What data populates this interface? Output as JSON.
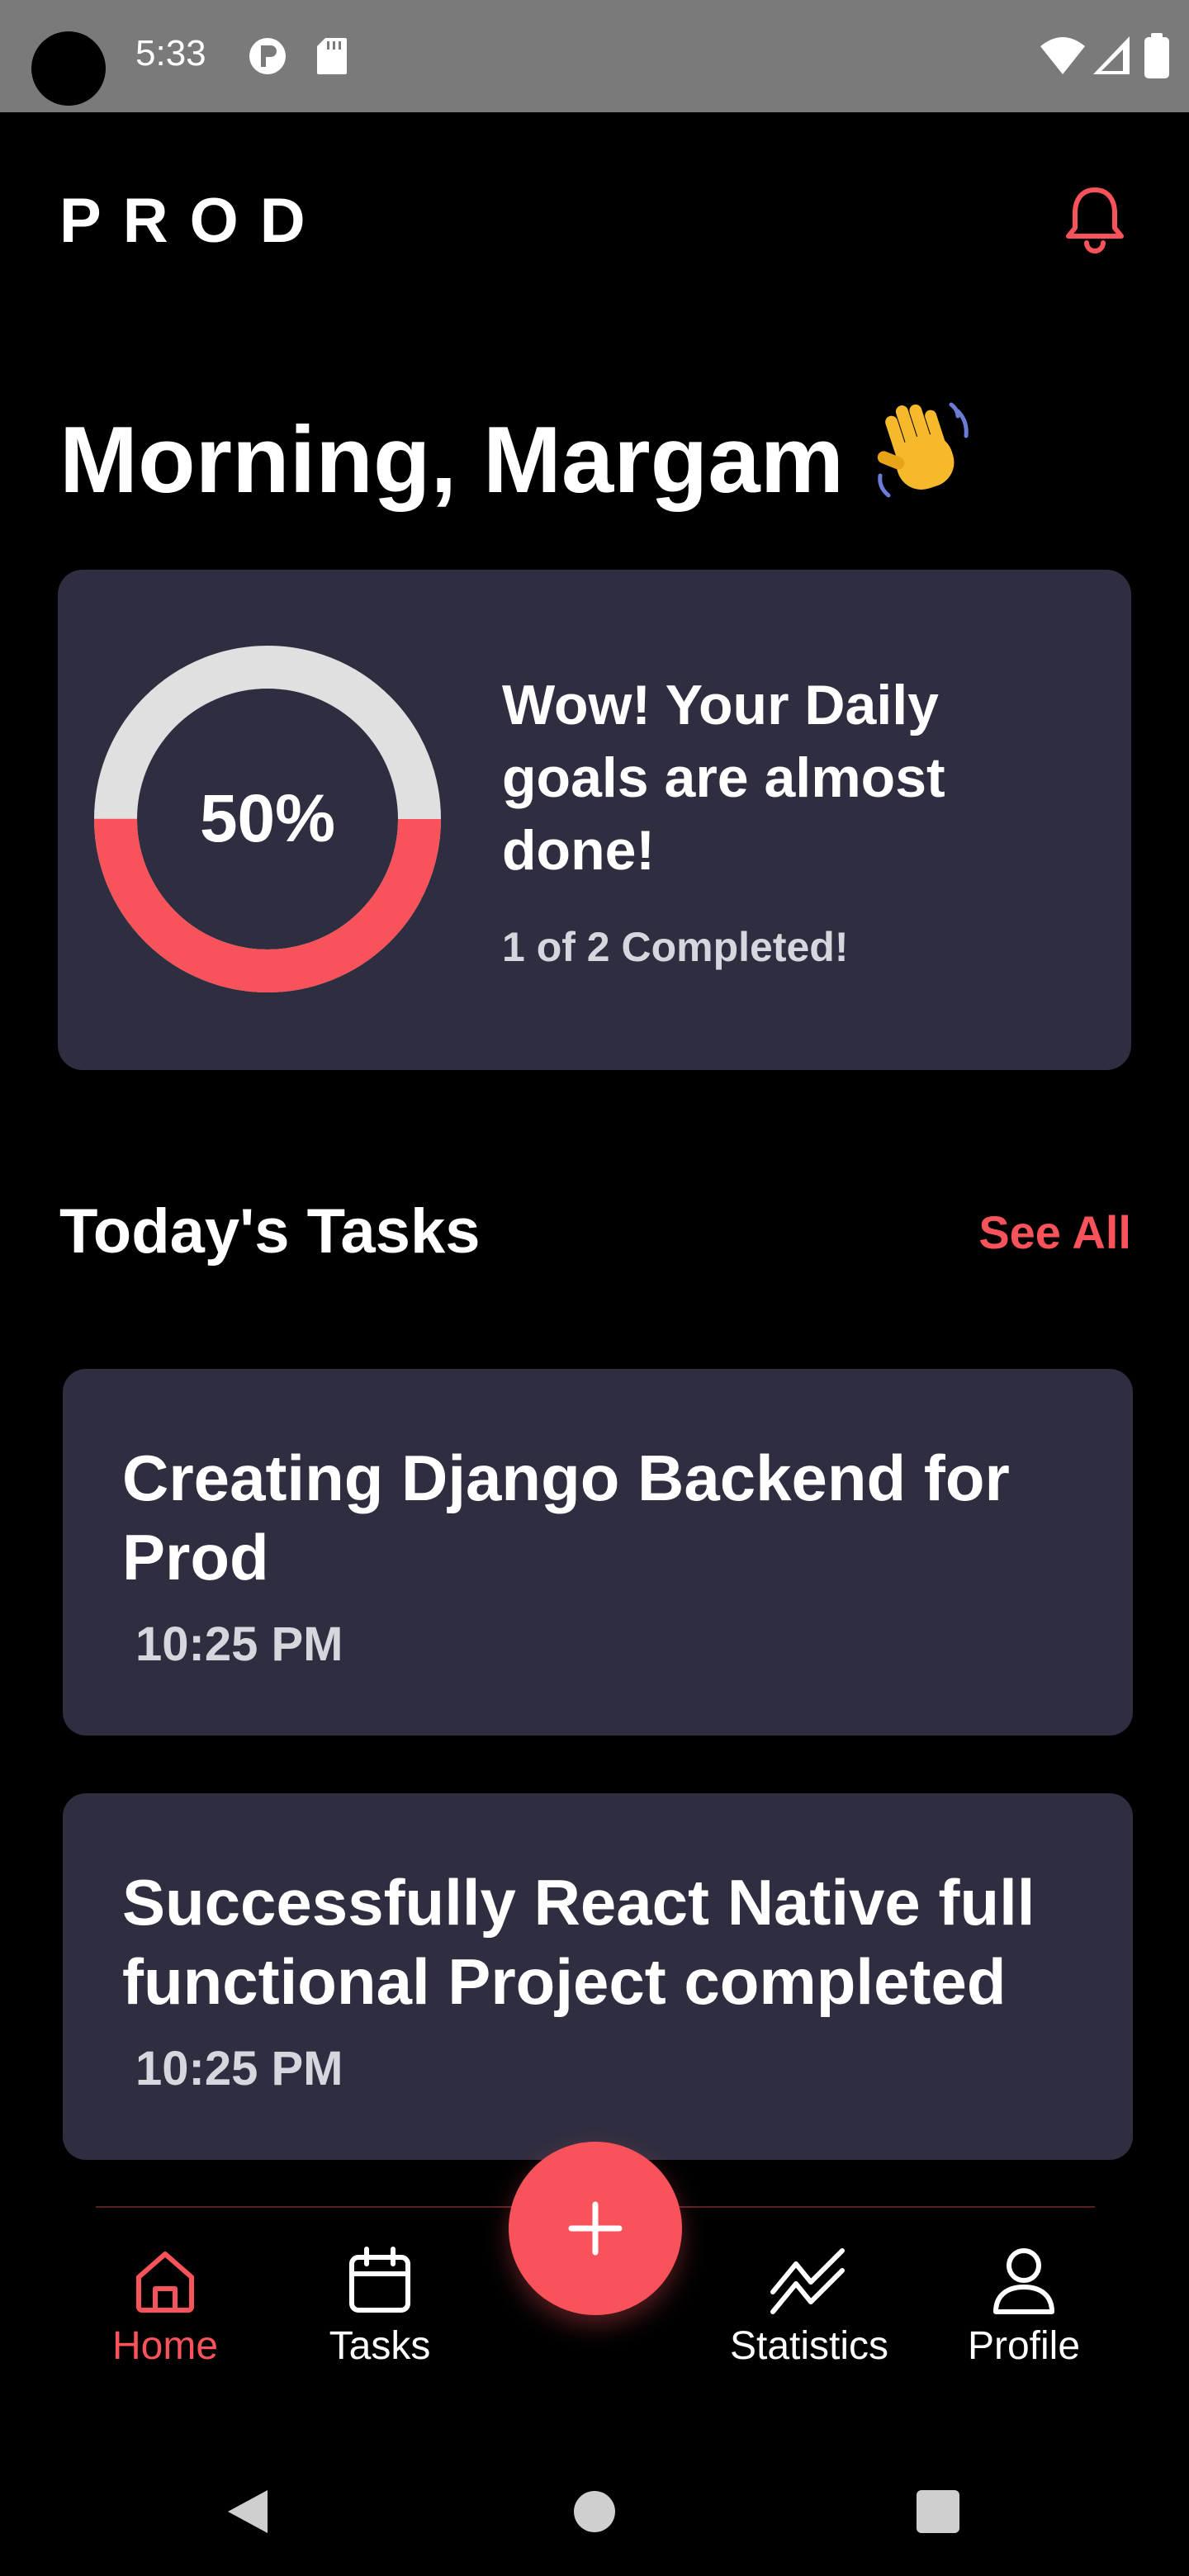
{
  "status_bar": {
    "time": "5:33",
    "icons": [
      "camera-cutout",
      "notification-p-icon",
      "sd-card-icon",
      "wifi-icon",
      "signal-icon",
      "battery-icon"
    ]
  },
  "header": {
    "logo": "PROD",
    "notification_icon": "bell-icon"
  },
  "greeting": {
    "text": "Morning, Margam",
    "emoji": "👋"
  },
  "progress_card": {
    "percent_label": "50%",
    "progress": 0.5,
    "title": "Wow! Your Daily goals are almost done!",
    "subtitle": "1 of 2 Completed!"
  },
  "tasks_section": {
    "title": "Today's Tasks",
    "see_all": "See All",
    "tasks": [
      {
        "title": "Creating Django Backend for Prod",
        "time": "10:25 PM"
      },
      {
        "title": "Successfully React Native full functional Project completed",
        "time": "10:25 PM"
      }
    ]
  },
  "bottom_nav": {
    "items": [
      {
        "label": "Home",
        "icon": "home-icon",
        "active": true
      },
      {
        "label": "Tasks",
        "icon": "calendar-icon",
        "active": false
      },
      {
        "label": "Statistics",
        "icon": "chart-line-icon",
        "active": false
      },
      {
        "label": "Profile",
        "icon": "user-icon",
        "active": false
      }
    ],
    "fab_icon": "plus-icon"
  },
  "system_nav": {
    "icons": [
      "back-icon",
      "home-circle-icon",
      "recents-icon"
    ]
  },
  "colors": {
    "accent": "#f8525b",
    "card_bg": "#2f2e41",
    "background": "#000000",
    "status_bar": "#7a7a7a",
    "ring_track": "#e0e0e0"
  }
}
